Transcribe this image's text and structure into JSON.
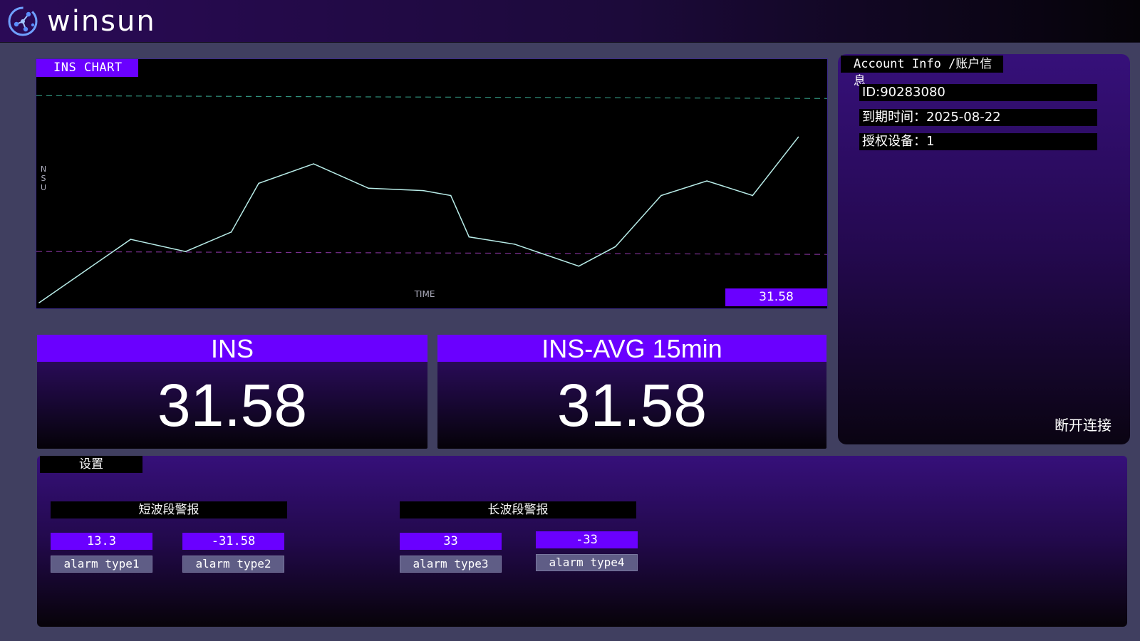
{
  "header": {
    "brand": "winsun",
    "logo_icon": "network-clock-icon"
  },
  "chart": {
    "tag": "INS CHART",
    "ylabel": "N\nS\nU",
    "xlabel": "TIME",
    "current_value": "31.58"
  },
  "chart_data": {
    "type": "line",
    "title": "INS CHART",
    "xlabel": "TIME",
    "ylabel": "NSU",
    "grid": false,
    "series": [
      {
        "color": "#b8ece8",
        "values": [
          {
            "x": 0,
            "y": 0
          },
          {
            "x": 5,
            "y": 26
          },
          {
            "x": 8,
            "y": 21
          },
          {
            "x": 10.5,
            "y": 29
          },
          {
            "x": 12,
            "y": 49
          },
          {
            "x": 15,
            "y": 57
          },
          {
            "x": 18,
            "y": 47
          },
          {
            "x": 21,
            "y": 46
          },
          {
            "x": 22.5,
            "y": 44
          },
          {
            "x": 23.5,
            "y": 27
          },
          {
            "x": 26,
            "y": 24
          },
          {
            "x": 29.5,
            "y": 15
          },
          {
            "x": 31.5,
            "y": 23
          },
          {
            "x": 34,
            "y": 44
          },
          {
            "x": 36.5,
            "y": 50
          },
          {
            "x": 39,
            "y": 44
          },
          {
            "x": 41.5,
            "y": 68
          }
        ]
      }
    ],
    "reference_lines": [
      {
        "y": 85,
        "color": "#2f8f7a"
      },
      {
        "y": 21,
        "color": "#7a2f8f"
      }
    ],
    "xlim": [
      0,
      43
    ],
    "ylim": [
      0,
      100
    ]
  },
  "cards": {
    "ins": {
      "title": "INS",
      "value": "31.58"
    },
    "avg": {
      "title": "INS-AVG 15min",
      "value": "31.58"
    }
  },
  "account": {
    "tag": "Account Info /账户信息",
    "id": "ID:90283080",
    "expiry": "到期时间：2025-08-22",
    "devices": "授权设备：1",
    "disconnect": "断开连接"
  },
  "settings": {
    "tag": "设置",
    "short_wave": {
      "title": "短波段警报",
      "alarm1": {
        "value": "13.3",
        "label": "alarm type1"
      },
      "alarm2": {
        "value": "-31.58",
        "label": "alarm type2"
      }
    },
    "long_wave": {
      "title": "长波段警报",
      "alarm3": {
        "value": "33",
        "label": "alarm type3"
      },
      "alarm4": {
        "value": "-33",
        "label": "alarm type4"
      }
    }
  },
  "colors": {
    "accent": "#6a00ff",
    "background": "#403f60",
    "line": "#b8ece8"
  }
}
